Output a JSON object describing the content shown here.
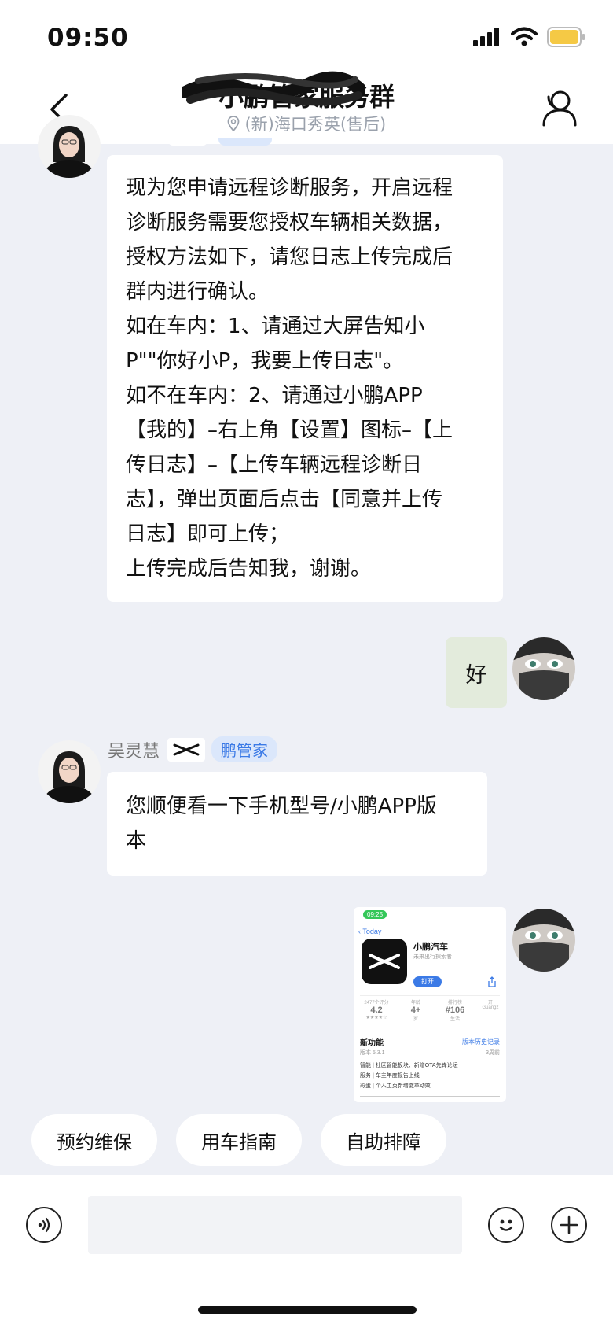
{
  "status_bar": {
    "time": "09:50",
    "battery_color": "#f5c945"
  },
  "header": {
    "title": "小鹏管家服务群",
    "subtitle": "(新)海口秀英(售后)",
    "icons": [
      "back-icon",
      "group-members-icon",
      "location-pin-icon"
    ]
  },
  "messages": [
    {
      "side": "left",
      "text": "现为您申请远程诊断服务，开启远程\n诊断服务需要您授权车辆相关数据，\n授权方法如下，请您日志上传完成后\n群内进行确认。\n如在车内：1、请通过大屏告知小\nP\"\"你好小P，我要上传日志\"。\n如不在车内：2、请通过小鹏APP\n【我的】–右上角【设置】图标–【上\n传日志】–【上传车辆远程诊断日\n志】，弹出页面后点击【同意并上传\n日志】即可上传；\n上传完成后告知我，谢谢。"
    },
    {
      "side": "right",
      "text": "好",
      "bubble_color": "#e3ebdc"
    },
    {
      "side": "left",
      "sender": "吴灵慧",
      "role": "鹏管家",
      "text": "您顺便看一下手机型号/小鹏APP版\n本"
    },
    {
      "side": "right",
      "type": "image",
      "screenshot": {
        "time": "09:25",
        "back_label": "Today",
        "app_name": "小鹏汽车",
        "app_subtitle": "未来出行探索者",
        "open_label": "打开",
        "stats": [
          {
            "top": "2477个评分",
            "mid": "4.2",
            "bot": "★★★★☆"
          },
          {
            "top": "年龄",
            "mid": "4+",
            "bot": "岁"
          },
          {
            "top": "排行榜",
            "mid": "#106",
            "bot": "生活"
          },
          {
            "top": "开",
            "mid": "",
            "bot": "Guangz"
          }
        ],
        "whats_new": "新功能",
        "history_label": "版本历史记录",
        "version": "版本 5.3.1",
        "time_ago": "3周前",
        "notes": [
          "智能 | 社区智能板块、新增OTA先锋论坛",
          "服务 | 车主年度报告上线",
          "彩蛋 | 个人主页新增徽章动效"
        ]
      }
    }
  ],
  "quick_actions": [
    "预约维保",
    "用车指南",
    "自助排障"
  ],
  "input_bar": {
    "icons": [
      "voice-icon",
      "emoji-icon",
      "plus-icon"
    ],
    "accent": "#3b7ae6"
  }
}
